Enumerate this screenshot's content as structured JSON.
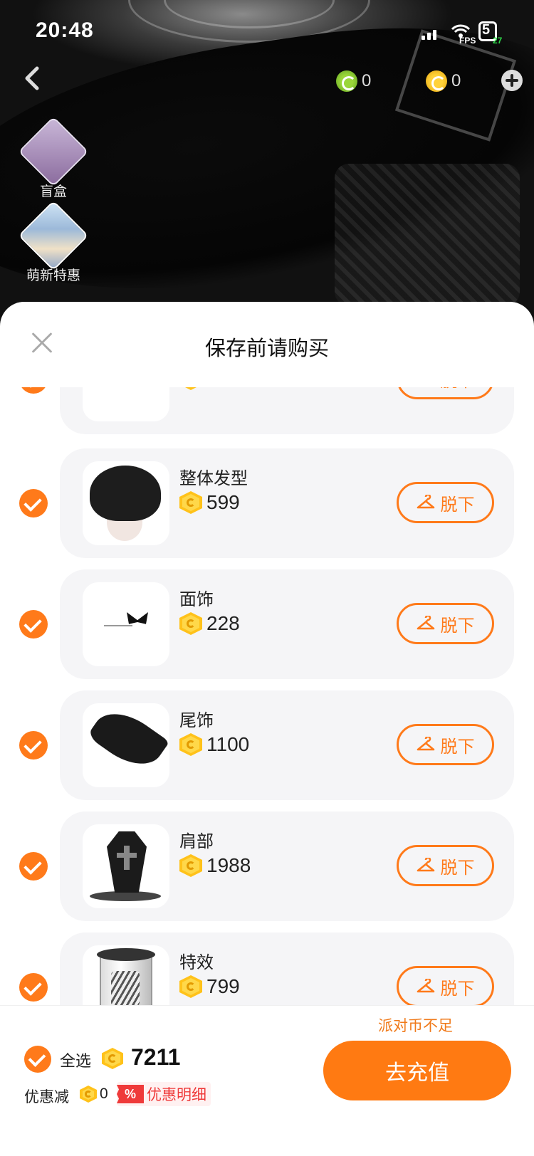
{
  "status_bar": {
    "time": "20:48",
    "battery": "5",
    "fps_label": "FPS",
    "fps_value": "27"
  },
  "header": {
    "balances": [
      {
        "icon": "green-coin-icon",
        "value": "0"
      },
      {
        "icon": "gold-coin-icon",
        "value": "0"
      }
    ]
  },
  "side_menu": [
    {
      "label": "盲盒",
      "icon": "gift-box-icon"
    },
    {
      "label": "萌新特惠",
      "icon": "newbie-deal-icon"
    }
  ],
  "sheet": {
    "title": "保存前请购买",
    "items": [
      {
        "name": "",
        "price": "",
        "action": "脱下",
        "thumb": "blank"
      },
      {
        "name": "整体发型",
        "price": "599",
        "action": "脱下",
        "thumb": "hair"
      },
      {
        "name": "面饰",
        "price": "228",
        "action": "脱下",
        "thumb": "butterfly"
      },
      {
        "name": "尾饰",
        "price": "1100",
        "action": "脱下",
        "thumb": "tail"
      },
      {
        "name": "肩部",
        "price": "1988",
        "action": "脱下",
        "thumb": "coffin"
      },
      {
        "name": "特效",
        "price": "799",
        "action": "脱下",
        "thumb": "effect"
      }
    ]
  },
  "footer": {
    "insufficient": "派对币不足",
    "select_all": "全选",
    "total": "7211",
    "discount_label": "优惠减",
    "discount_value": "0",
    "discount_badge": "%",
    "discount_detail": "优惠明细",
    "recharge": "去充值"
  },
  "colors": {
    "accent": "#ff7a1a",
    "danger": "#ef3a3a",
    "card_bg": "#f5f5f7"
  }
}
